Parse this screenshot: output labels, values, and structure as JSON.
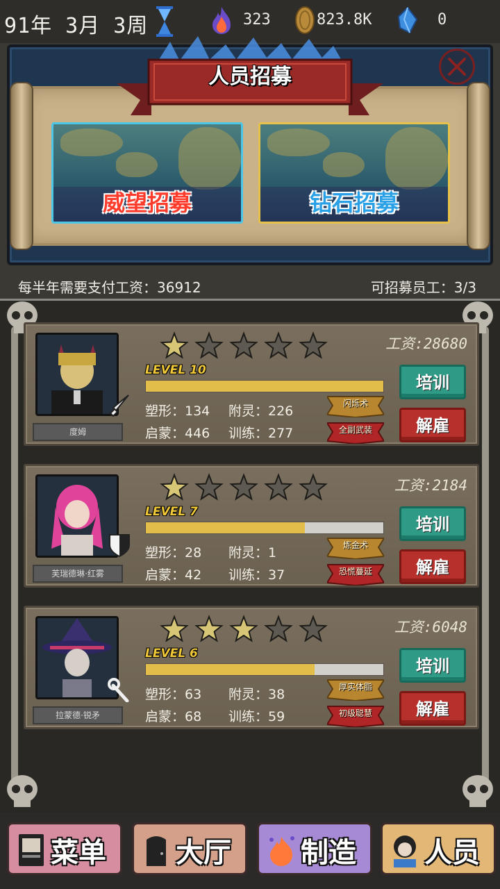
{
  "topbar": {
    "date": "91年 3月 3周",
    "flame_value": "323",
    "coin_value": "823.8K",
    "gem_value": "0"
  },
  "recruit": {
    "title": "人员招募",
    "prestige_label": "威望招募",
    "diamond_label": "钻石招募"
  },
  "info": {
    "salary_due": "每半年需要支付工资：36912",
    "recruitable": "可招募员工：3/3"
  },
  "staff": [
    {
      "name": "度姆",
      "salary": "工资:28680",
      "level_label": "LEVEL",
      "level": "10",
      "stars": 1,
      "xp_fraction": 1.0,
      "stats": {
        "shape": "塑形：134",
        "spirit": "附灵：226",
        "enlighten": "启蒙：446",
        "train": "训练：277"
      },
      "traits": [
        "闪烁术",
        "全副武装"
      ],
      "train_label": "培训",
      "fire_label": "解雇"
    },
    {
      "name": "芙瑞德琳·红雾",
      "salary": "工资:2184",
      "level_label": "LEVEL",
      "level": "7",
      "stars": 1,
      "xp_fraction": 0.67,
      "stats": {
        "shape": "塑形：28",
        "spirit": "附灵：1",
        "enlighten": "启蒙：42",
        "train": "训练：37"
      },
      "traits": [
        "炼金术",
        "恐慌蔓延"
      ],
      "train_label": "培训",
      "fire_label": "解雇"
    },
    {
      "name": "拉蒙德·锐矛",
      "salary": "工资:6048",
      "level_label": "LEVEL",
      "level": "6",
      "stars": 3,
      "xp_fraction": 0.71,
      "stats": {
        "shape": "塑形：63",
        "spirit": "附灵：38",
        "enlighten": "启蒙：68",
        "train": "训练：59"
      },
      "traits": [
        "厚实体脂",
        "初级聪慧"
      ],
      "train_label": "培训",
      "fire_label": "解雇"
    }
  ],
  "nav": {
    "menu": "菜单",
    "hall": "大厅",
    "craft": "制造",
    "staff": "人员"
  },
  "colors": {
    "accent_teal": "#2f9a86",
    "accent_red": "#b8302c",
    "star_gold": "#d8c677",
    "xp_gold": "#e3bd49"
  }
}
